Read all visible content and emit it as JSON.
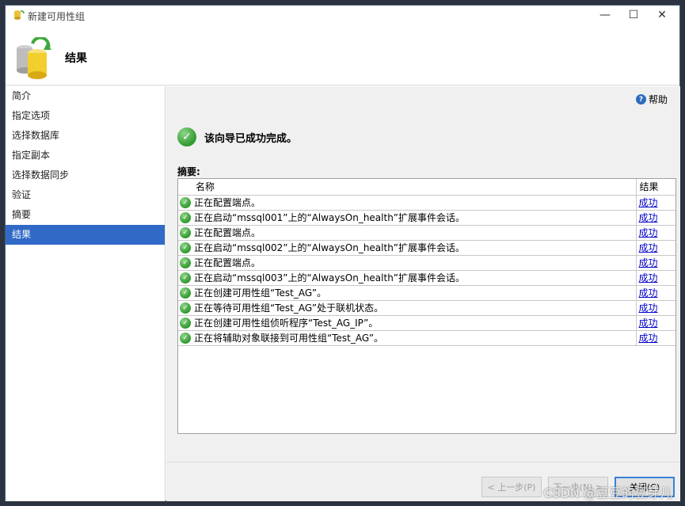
{
  "window": {
    "title": "新建可用性组"
  },
  "header": {
    "page_title": "结果"
  },
  "sidebar": {
    "items": [
      {
        "label": "简介"
      },
      {
        "label": "指定选项"
      },
      {
        "label": "选择数据库"
      },
      {
        "label": "指定副本"
      },
      {
        "label": "选择数据同步"
      },
      {
        "label": "验证"
      },
      {
        "label": "摘要"
      },
      {
        "label": "结果",
        "active": true
      }
    ]
  },
  "content": {
    "help_label": "帮助",
    "success_message": "该向导已成功完成。",
    "summary_label": "摘要:",
    "table": {
      "columns": [
        "名称",
        "结果"
      ],
      "rows": [
        {
          "name": "正在配置端点。",
          "result": "成功"
        },
        {
          "name": "正在启动“mssql001”上的“AlwaysOn_health”扩展事件会话。",
          "result": "成功"
        },
        {
          "name": "正在配置端点。",
          "result": "成功"
        },
        {
          "name": "正在启动“mssql002”上的“AlwaysOn_health”扩展事件会话。",
          "result": "成功"
        },
        {
          "name": "正在配置端点。",
          "result": "成功"
        },
        {
          "name": "正在启动“mssql003”上的“AlwaysOn_health”扩展事件会话。",
          "result": "成功"
        },
        {
          "name": "正在创建可用性组“Test_AG”。",
          "result": "成功"
        },
        {
          "name": "正在等待可用性组“Test_AG”处于联机状态。",
          "result": "成功"
        },
        {
          "name": "正在创建可用性组侦听程序“Test_AG_IP”。",
          "result": "成功"
        },
        {
          "name": "正在将辅助对象联接到可用性组“Test_AG”。",
          "result": "成功"
        }
      ]
    }
  },
  "footer": {
    "prev_label": "< 上一步(P)",
    "next_label": "下一步(N) >",
    "close_label": "关闭(C)"
  },
  "watermark": "CSDN @豆豆的豆芽儿",
  "colors": {
    "accent": "#3169c6",
    "success": "#2f9a2c",
    "link": "#0000cc"
  }
}
